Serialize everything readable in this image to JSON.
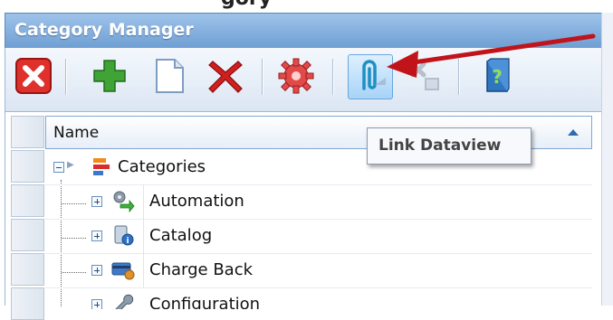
{
  "window": {
    "title": "Category Manager"
  },
  "toolbar": {
    "buttons": [
      {
        "name": "close-button",
        "icon": "close-red-icon"
      },
      {
        "name": "add-button",
        "icon": "plus-icon"
      },
      {
        "name": "new-document-button",
        "icon": "document-icon"
      },
      {
        "name": "delete-button",
        "icon": "delete-x-icon"
      },
      {
        "name": "settings-button",
        "icon": "gear-icon"
      },
      {
        "name": "link-dataview-button",
        "icon": "paperclip-link-icon"
      },
      {
        "name": "unlink-dataview-button",
        "icon": "unlink-icon"
      },
      {
        "name": "help-button",
        "icon": "help-book-icon"
      }
    ]
  },
  "grid": {
    "column_header": "Name",
    "sort": "ascending",
    "tree": {
      "root": {
        "label": "Categories",
        "expanded": true
      },
      "children": [
        {
          "label": "Automation"
        },
        {
          "label": "Catalog"
        },
        {
          "label": "Charge Back"
        },
        {
          "label": "Configuration"
        }
      ]
    }
  },
  "tooltip": {
    "text": "Link Dataview"
  },
  "colors": {
    "accent": "#6f9fd3",
    "annotation_arrow": "#c0141a"
  }
}
